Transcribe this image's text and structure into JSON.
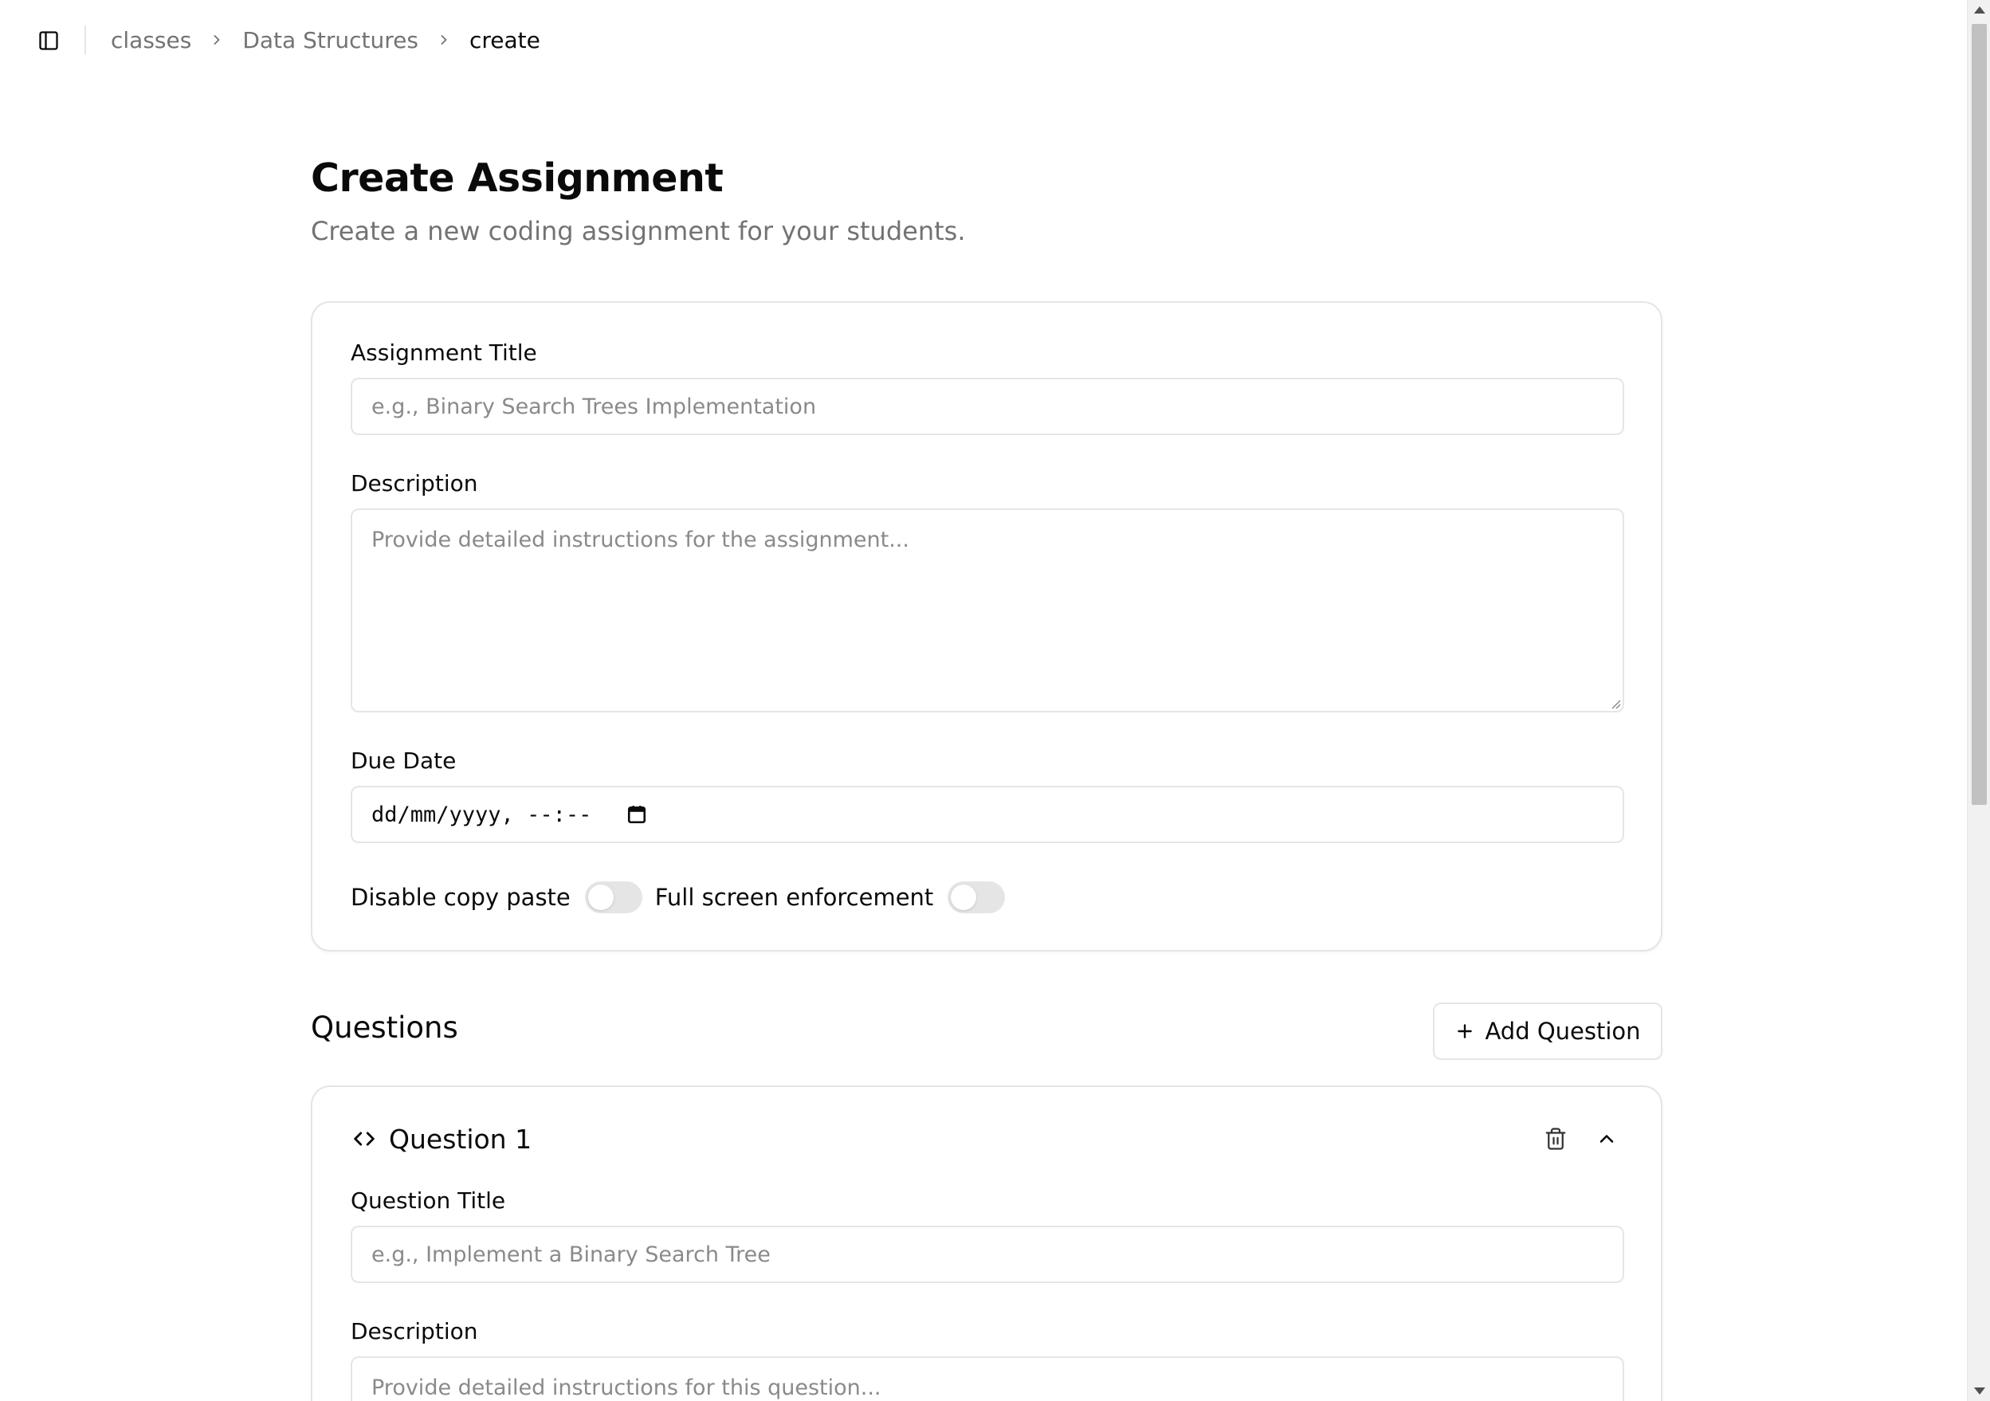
{
  "breadcrumb": {
    "items": [
      "classes",
      "Data Structures",
      "create"
    ]
  },
  "page": {
    "title": "Create Assignment",
    "subtitle": "Create a new coding assignment for your students."
  },
  "assignment_form": {
    "title_label": "Assignment Title",
    "title_placeholder": "e.g., Binary Search Trees Implementation",
    "title_value": "",
    "description_label": "Description",
    "description_placeholder": "Provide detailed instructions for the assignment...",
    "description_value": "",
    "due_date_label": "Due Date",
    "due_date_display": "dd/mm/yyyy, --:--",
    "disable_copy_paste_label": "Disable copy paste",
    "disable_copy_paste_on": false,
    "full_screen_label": "Full screen enforcement",
    "full_screen_on": false
  },
  "questions": {
    "section_title": "Questions",
    "add_button_label": "Add Question",
    "items": [
      {
        "heading": "Question 1",
        "title_label": "Question Title",
        "title_placeholder": "e.g., Implement a Binary Search Tree",
        "description_label": "Description",
        "description_placeholder": "Provide detailed instructions for this question..."
      }
    ]
  },
  "icons": {
    "sidebar_toggle": "sidebar-toggle-icon",
    "breadcrumb_separator": "chevron-right-icon",
    "calendar": "calendar-icon",
    "add": "plus-icon",
    "question": "code-icon",
    "delete": "trash-icon",
    "collapse": "chevron-up-icon"
  },
  "colors": {
    "border": "#e5e5e5",
    "muted_text": "#737373",
    "text": "#0a0a0a",
    "switch_off": "#e5e5e5"
  }
}
